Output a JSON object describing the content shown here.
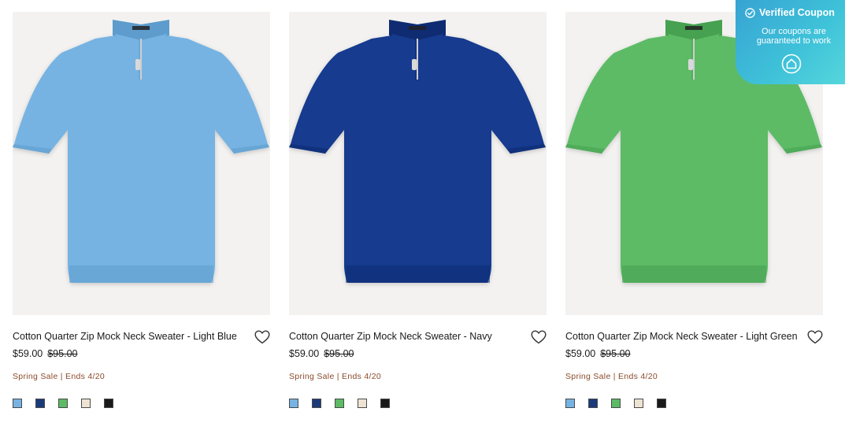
{
  "products": [
    {
      "title": "Cotton Quarter Zip Mock Neck Sweater - Light Blue",
      "price_sale": "$59.00",
      "price_original": "$95.00",
      "promo": "Spring Sale | Ends 4/20",
      "color": "#76b3e3",
      "color_dark": "#5d9ccc"
    },
    {
      "title": "Cotton Quarter Zip Mock Neck Sweater - Navy",
      "price_sale": "$59.00",
      "price_original": "$95.00",
      "promo": "Spring Sale | Ends 4/20",
      "color": "#173b8f",
      "color_dark": "#0f2c72"
    },
    {
      "title": "Cotton Quarter Zip Mock Neck Sweater - Light Green",
      "price_sale": "$59.00",
      "price_original": "$95.00",
      "promo": "Spring Sale | Ends 4/20",
      "color": "#5dbb66",
      "color_dark": "#46a150"
    }
  ],
  "swatch_colors": [
    "#76b3e3",
    "#1b3a7a",
    "#5dbb66",
    "#eee3d3",
    "#1a1a1a"
  ],
  "coupon": {
    "title": "Verified Coupon",
    "line1": "Our coupons are",
    "line2": "guaranteed to work",
    "icon": "house-icon"
  },
  "icons": {
    "wishlist": "heart-outline-icon",
    "badge": "check-circle-icon"
  }
}
